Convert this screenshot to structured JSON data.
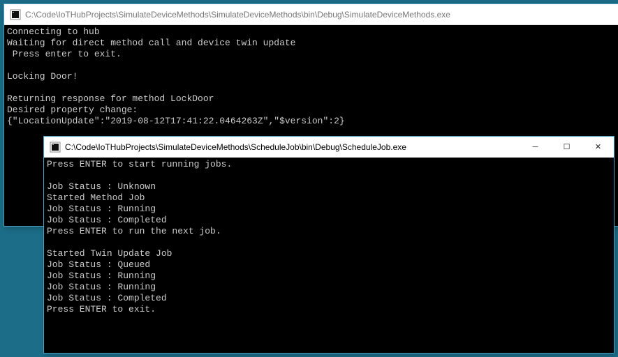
{
  "windows": {
    "back": {
      "title": "C:\\Code\\IoTHubProjects\\SimulateDeviceMethods\\SimulateDeviceMethods\\bin\\Debug\\SimulateDeviceMethods.exe",
      "lines": [
        "Connecting to hub",
        "Waiting for direct method call and device twin update",
        " Press enter to exit.",
        "",
        "Locking Door!",
        "",
        "Returning response for method LockDoor",
        "Desired property change:",
        "{\"LocationUpdate\":\"2019-08-12T17:41:22.0464263Z\",\"$version\":2}"
      ]
    },
    "front": {
      "title": "C:\\Code\\IoTHubProjects\\SimulateDeviceMethods\\ScheduleJob\\bin\\Debug\\ScheduleJob.exe",
      "lines": [
        "Press ENTER to start running jobs.",
        "",
        "Job Status : Unknown",
        "Started Method Job",
        "Job Status : Running",
        "Job Status : Completed",
        "Press ENTER to run the next job.",
        "",
        "Started Twin Update Job",
        "Job Status : Queued",
        "Job Status : Running",
        "Job Status : Running",
        "Job Status : Completed",
        "Press ENTER to exit."
      ]
    }
  },
  "controls": {
    "minimize": "─",
    "maximize": "☐",
    "close": "✕",
    "scroll_up": "▴",
    "scroll_down": "▾"
  },
  "colors": {
    "desktop_bg": "#1c6d88",
    "console_bg": "#000000",
    "console_fg": "#cccccc"
  }
}
